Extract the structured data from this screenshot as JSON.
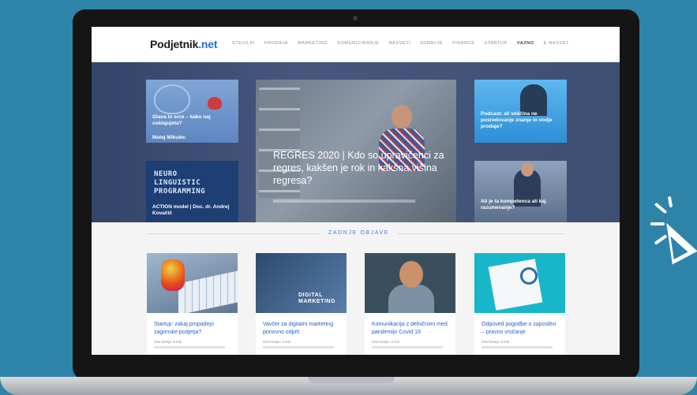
{
  "site": {
    "logo_main": "Podjetnik",
    "logo_tld": ".net"
  },
  "nav": {
    "items": [
      {
        "label": "STEVILKI"
      },
      {
        "label": "PRODAJA"
      },
      {
        "label": "MARKETING"
      },
      {
        "label": "KOMUNICIRANJE"
      },
      {
        "label": "NASVETI"
      },
      {
        "label": "ZDRAVJE"
      },
      {
        "label": "FINANCE"
      },
      {
        "label": "STARTUP"
      },
      {
        "label": "VAZNO"
      },
      {
        "label": "E-NASVET"
      }
    ],
    "active_index": 8
  },
  "hero": {
    "left_top": {
      "caption": "Glava in srce – kako naj usklajujeta?",
      "caption2": "Matej Mikulec"
    },
    "left_bottom": {
      "image_text": [
        "NEURO",
        "LINGUISTIC",
        "PROGRAMMING"
      ],
      "caption": "ACTION model | Doc. dr. Andrej Kovačič"
    },
    "main": {
      "caption": "REGRES 2020 | Kdo so upravičenci za regres, kakšen je rok in kakšna višina regresa?"
    },
    "right_top": {
      "caption": "Podcast: ali veščina ne posredovanje znanje in vodje prodaje?"
    },
    "right_bottom": {
      "caption": "Ali je ta kompetenca ali kaj razumevanje?"
    }
  },
  "section": {
    "title": "ZADNJE OBJAVE"
  },
  "posts": [
    {
      "title": "Startup: zakaj propadejo zagonske podjetja?",
      "meta": "Čas branja: 6 min"
    },
    {
      "title": "Vavčer za digitalni marketing ponovno odprt!",
      "meta": "Čas branja: 2 min",
      "image_text": "DIGITAL MARKETING"
    },
    {
      "title": "Komunikacija z delničnimi med pandemijo Covid 19",
      "meta": "Čas branja: 3 min"
    },
    {
      "title": "Odpoved pogodbe o zaposlitvi – pravno vročanje",
      "meta": "Čas branja: 3 min"
    }
  ],
  "colors": {
    "background": "#2d84a8",
    "accent": "#2563c4",
    "hero_overlay": "#284690"
  }
}
